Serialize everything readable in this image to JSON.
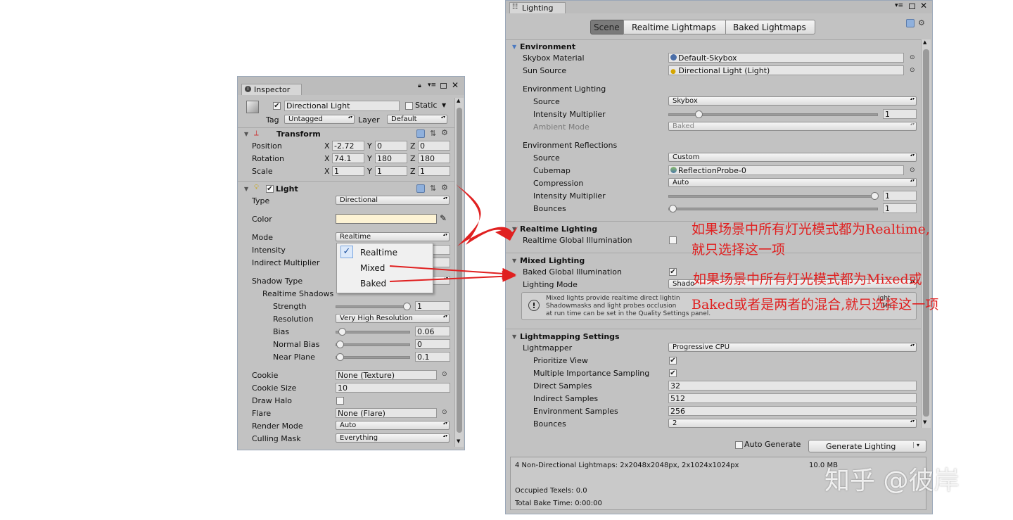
{
  "inspector": {
    "tab": "Inspector",
    "object_name": "Directional Light",
    "static_label": "Static",
    "tag_label": "Tag",
    "tag_value": "Untagged",
    "layer_label": "Layer",
    "layer_value": "Default",
    "transform": {
      "title": "Transform",
      "rows": [
        {
          "label": "Position",
          "x": "-2.72",
          "y": "0",
          "z": "0"
        },
        {
          "label": "Rotation",
          "x": "74.1",
          "y": "180",
          "z": "180"
        },
        {
          "label": "Scale",
          "x": "1",
          "y": "1",
          "z": "1"
        }
      ],
      "axis_x": "X",
      "axis_y": "Y",
      "axis_z": "Z"
    },
    "light": {
      "title": "Light",
      "type_label": "Type",
      "type_value": "Directional",
      "color_label": "Color",
      "color_value": "#fdf3d4",
      "mode_label": "Mode",
      "mode_value": "Realtime",
      "intensity_label": "Intensity",
      "indirect_label": "Indirect Multiplier",
      "shadow_type_label": "Shadow Type",
      "realtime_shadows_label": "Realtime Shadows",
      "strength_label": "Strength",
      "strength_value": "1",
      "strength_level": 1.0,
      "resolution_label": "Resolution",
      "resolution_value": "Very High Resolution",
      "bias_label": "Bias",
      "bias_value": "0.06",
      "bias_level": 0.03,
      "normal_bias_label": "Normal Bias",
      "normal_bias_value": "0",
      "normal_bias_level": 0.0,
      "near_plane_label": "Near Plane",
      "near_plane_value": "0.1",
      "near_plane_level": 0.0,
      "cookie_label": "Cookie",
      "cookie_value": "None (Texture)",
      "cookie_size_label": "Cookie Size",
      "cookie_size_value": "10",
      "draw_halo_label": "Draw Halo",
      "flare_label": "Flare",
      "flare_value": "None (Flare)",
      "render_mode_label": "Render Mode",
      "render_mode_value": "Auto",
      "culling_mask_label": "Culling Mask",
      "culling_mask_value": "Everything"
    },
    "mode_menu": {
      "items": [
        "Realtime",
        "Mixed",
        "Baked"
      ],
      "checked": "Realtime"
    }
  },
  "lighting": {
    "tab": "Lighting",
    "tabs": [
      "Scene",
      "Realtime Lightmaps",
      "Baked Lightmaps"
    ],
    "active_tab": "Scene",
    "environment": {
      "title": "Environment",
      "skybox_label": "Skybox Material",
      "skybox_value": "Default-Skybox",
      "sun_label": "Sun Source",
      "sun_value": "Directional Light (Light)",
      "env_lighting_label": "Environment Lighting",
      "source_label": "Source",
      "source_value": "Skybox",
      "intensity_label": "Intensity Multiplier",
      "intensity_value": "1",
      "intensity_level": 0.13,
      "ambient_label": "Ambient Mode",
      "ambient_value": "Baked",
      "env_reflections_label": "Environment Reflections",
      "refl_source_label": "Source",
      "refl_source_value": "Custom",
      "cubemap_label": "Cubemap",
      "cubemap_value": "ReflectionProbe-0",
      "compression_label": "Compression",
      "compression_value": "Auto",
      "refl_intensity_label": "Intensity Multiplier",
      "refl_intensity_value": "1",
      "refl_intensity_level": 1.0,
      "bounces_label": "Bounces",
      "bounces_value": "1",
      "bounces_level": 0.0
    },
    "realtime": {
      "title": "Realtime Lighting",
      "rgi_label": "Realtime Global Illumination"
    },
    "mixed": {
      "title": "Mixed Lighting",
      "bgi_label": "Baked Global Illumination",
      "mode_label": "Lighting Mode",
      "mode_value": "Shado",
      "info_line1": "Mixed lights provide realtime direct lightin",
      "info_line1b": "ight",
      "info_line2": "Shadowmasks and light probes occlusion",
      "info_line2b": "Ma",
      "info_line3": "at run time can be set in the Quality Settings panel."
    },
    "lightmapping": {
      "title": "Lightmapping Settings",
      "lightmapper_label": "Lightmapper",
      "lightmapper_value": "Progressive CPU",
      "prioritize_label": "Prioritize View",
      "mis_label": "Multiple Importance Sampling",
      "direct_label": "Direct Samples",
      "direct_value": "32",
      "indirect_label": "Indirect Samples",
      "indirect_value": "512",
      "env_samples_label": "Environment Samples",
      "env_samples_value": "256",
      "bounces_label": "Bounces",
      "bounces_value": "2"
    },
    "auto_generate_label": "Auto Generate",
    "generate_label": "Generate Lighting",
    "stats": {
      "line1": "4 Non-Directional Lightmaps: 2x2048x2048px, 2x1024x1024px",
      "size": "10.0 MB",
      "occupied": "Occupied Texels: 0.0",
      "bake_time": "Total Bake Time: 0:00:00"
    }
  },
  "annotations": {
    "note1_line1": "如果场景中所有灯光模式都为Realtime,",
    "note1_line2": "就只选择这一项",
    "note2_line1": "如果场景中所有灯光模式都为Mixed或",
    "note2_line2": "Baked或者是两者的混合,就只选择这一项",
    "arrow_color": "#e02020"
  },
  "watermark": "知乎 @彼岸"
}
